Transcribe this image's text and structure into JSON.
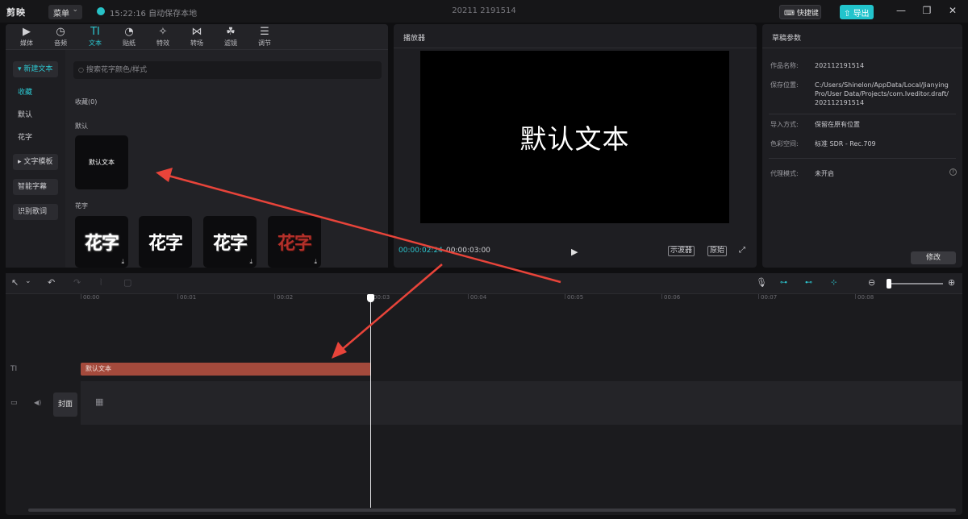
{
  "titlebar": {
    "app_name": "剪映",
    "menu_label": "菜单",
    "autosave_text": "15:22:16 自动保存本地",
    "project_title": "20211 2191514",
    "shortcuts_label": "快捷键",
    "export_label": "导出",
    "minimize_glyph": "—",
    "restore_glyph": "❐",
    "close_glyph": "✕"
  },
  "toolbar": {
    "tabs": [
      {
        "label": "媒体",
        "icon": "media-icon",
        "glyph": "▶"
      },
      {
        "label": "音频",
        "icon": "audio-icon",
        "glyph": "◷"
      },
      {
        "label": "文本",
        "icon": "text-icon",
        "glyph": "TI"
      },
      {
        "label": "贴纸",
        "icon": "sticker-icon",
        "glyph": "◔"
      },
      {
        "label": "特效",
        "icon": "effects-icon",
        "glyph": "✧"
      },
      {
        "label": "转场",
        "icon": "transition-icon",
        "glyph": "⋈"
      },
      {
        "label": "滤镜",
        "icon": "filter-icon",
        "glyph": "☘"
      },
      {
        "label": "调节",
        "icon": "adjust-icon",
        "glyph": "☰"
      }
    ],
    "active_tab": "文本"
  },
  "sidenav": {
    "items": [
      {
        "label": "▾ 新建文本"
      },
      {
        "label": "收藏"
      },
      {
        "label": "默认"
      },
      {
        "label": "花字"
      },
      {
        "label": "▸ 文字模板"
      },
      {
        "label": "智能字幕"
      },
      {
        "label": "识别歌词"
      }
    ]
  },
  "content": {
    "search_placeholder": "搜索花字颜色/样式",
    "favorites_label": "收藏(0)",
    "default_label": "默认",
    "default_card_text": "默认文本",
    "fancy_label": "花字",
    "fancy_cards": [
      "花字",
      "花字",
      "花字",
      "花字"
    ]
  },
  "player": {
    "title": "播放器",
    "screen_text": "默认文本",
    "current_time": "00:00:02:24",
    "total_time": "00:00:03:00",
    "play_glyph": "▶",
    "oscilloscope_label": "示波器",
    "original_label": "原始",
    "fullscreen_glyph": "⤢"
  },
  "props": {
    "title": "草稿参数",
    "rows": [
      {
        "key": "作品名称:",
        "value": "202112191514"
      },
      {
        "key": "保存位置:",
        "value": "C:/Users/Shinelon/AppData/Local/Jianying Pro/User Data/Projects/com.lveditor.draft/ 202112191514"
      },
      {
        "key": "导入方式:",
        "value": "保留在原有位置"
      },
      {
        "key": "色彩空间:",
        "value": "标准 SDR - Rec.709"
      },
      {
        "key": "代理模式:",
        "value": "未开启"
      }
    ],
    "help_glyph": "?",
    "modify_label": "修改"
  },
  "timeline": {
    "ruler_labels": [
      "00:00",
      "00:01",
      "00:02",
      "00:03",
      "00:04",
      "00:05",
      "00:06",
      "00:07",
      "00:08"
    ],
    "text_track_icon": "TI",
    "text_clip_label": "默认文本",
    "cover_label": "封面",
    "tools": {
      "select": "↖",
      "select_chev": "⌄",
      "undo": "↶",
      "redo": "↷",
      "split": "⦚",
      "delete": "▢",
      "mic": "🎙",
      "zoom_out": "⊖",
      "zoom_in": "⊕",
      "snap_a": "⊶",
      "snap_b": "⊷",
      "snap_c": "⊹"
    },
    "video_icon": "▭",
    "audio_icon": "◀)",
    "film_icon": "▦"
  },
  "colors": {
    "accent": "#2cc6cf",
    "text_clip": "#a44a3c",
    "arrow": "#e8443a"
  }
}
